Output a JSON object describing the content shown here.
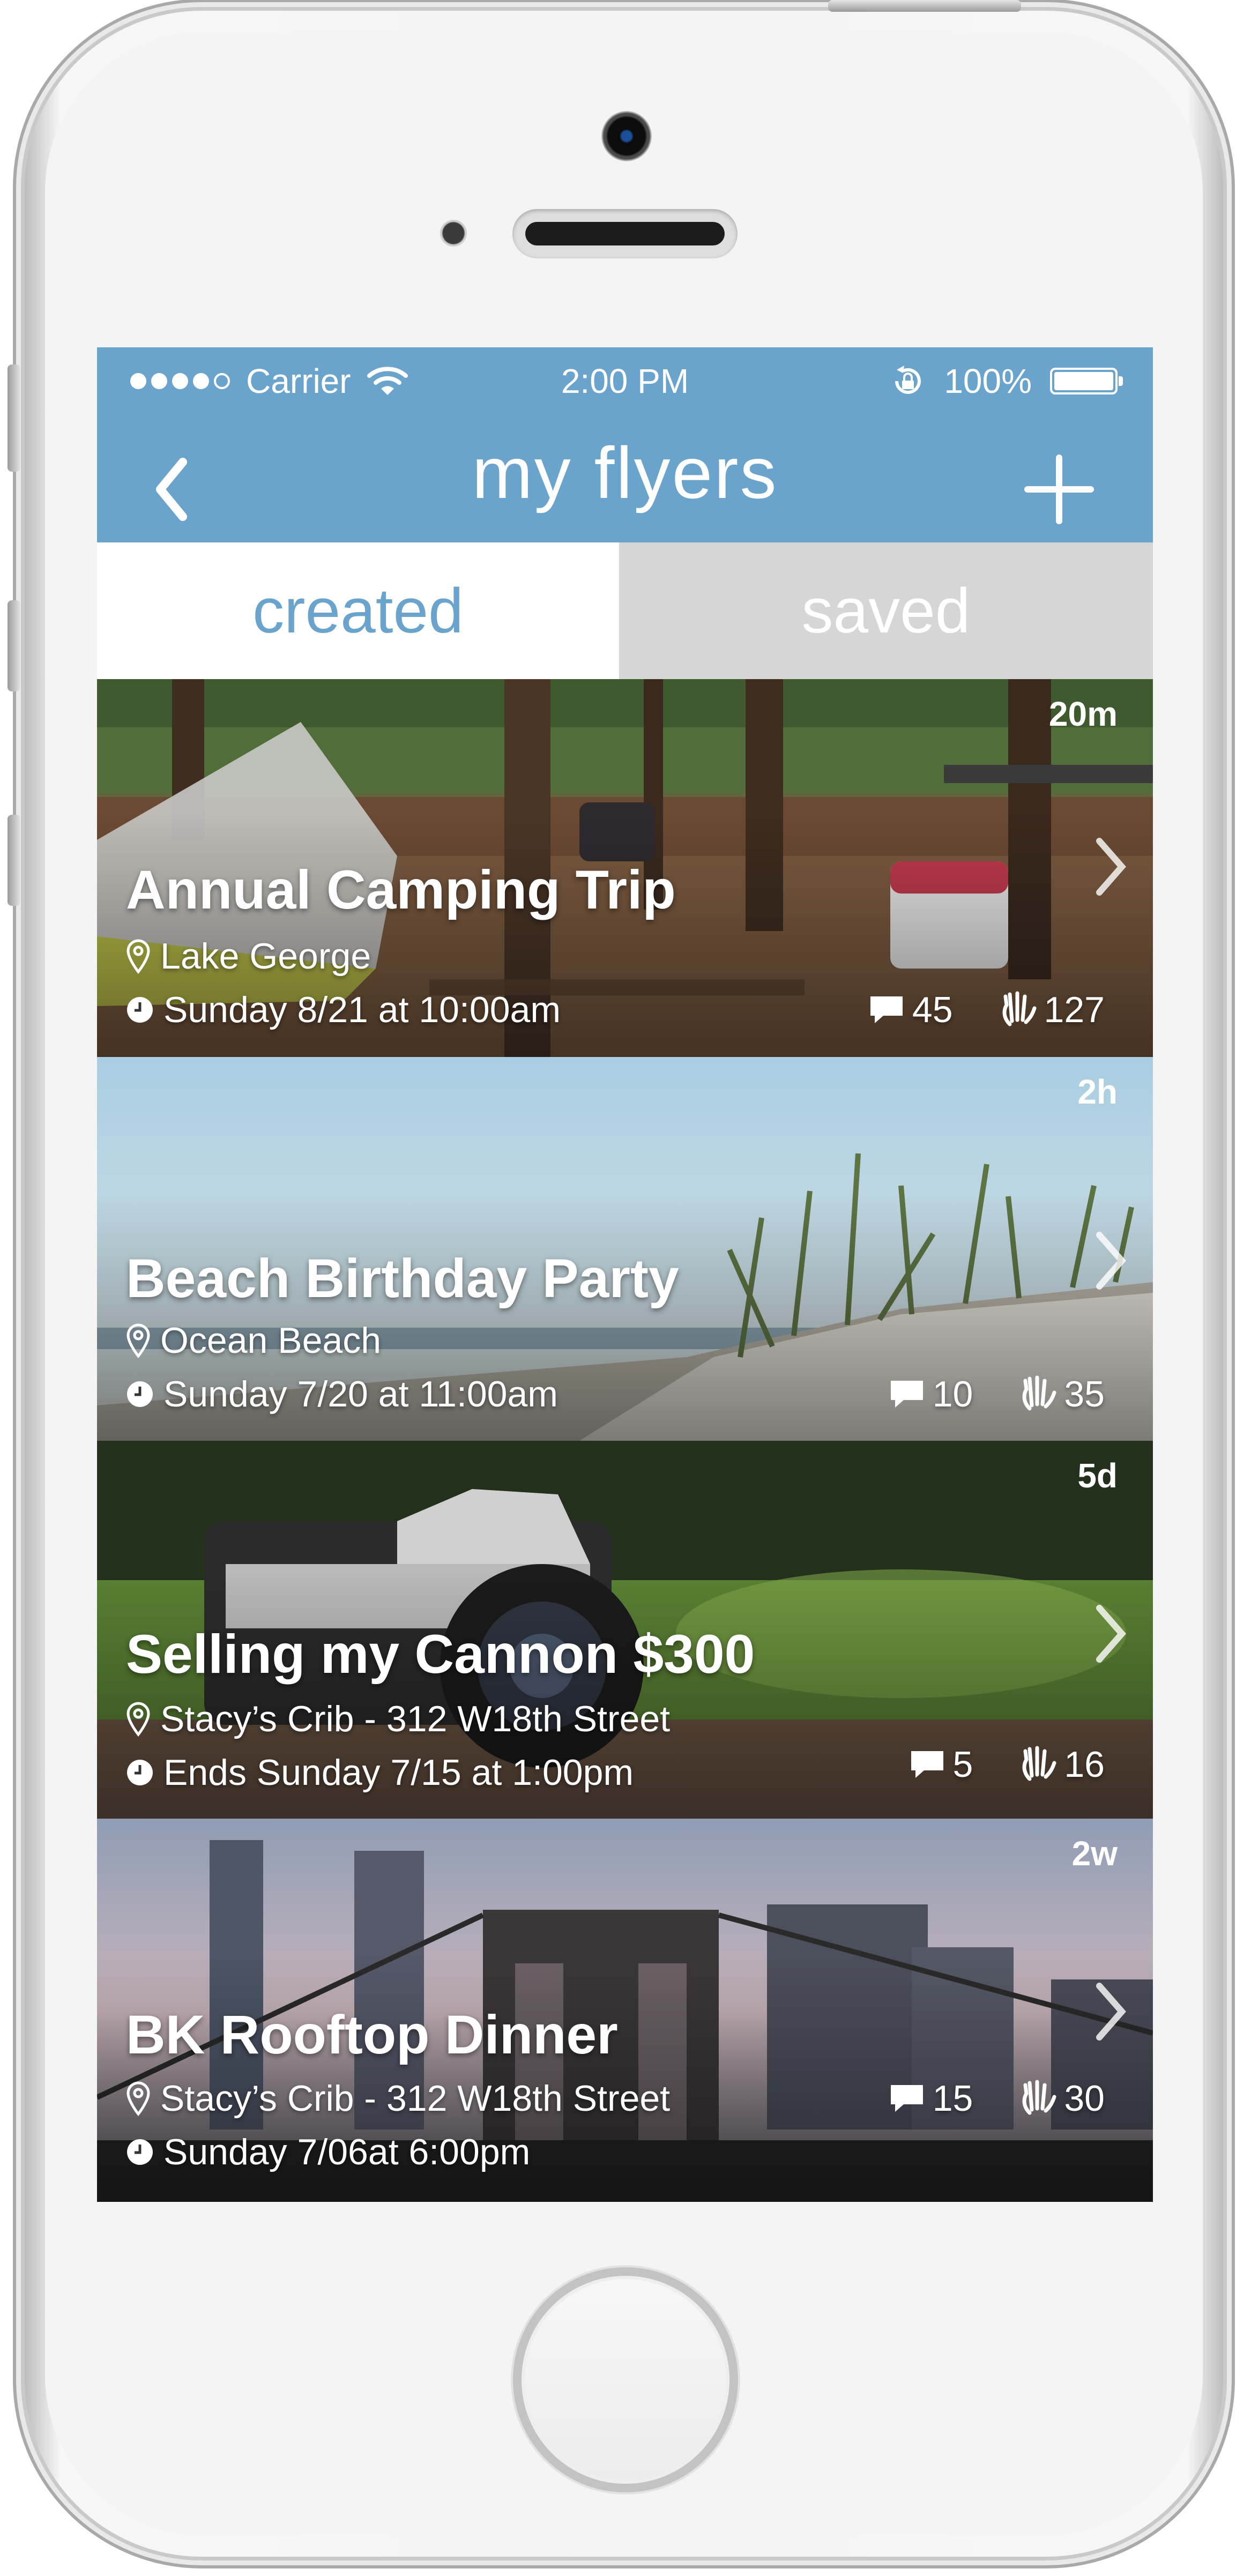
{
  "status_bar": {
    "carrier": "Carrier",
    "time": "2:00 PM",
    "battery": "100%"
  },
  "nav": {
    "title": "my flyers",
    "back_icon": "chevron-left-icon",
    "add_icon": "plus-icon"
  },
  "tabs": {
    "created": "created",
    "saved": "saved",
    "active": "created"
  },
  "flyers": [
    {
      "title": "Annual Camping Trip",
      "location": "Lake George",
      "when": "Sunday 8/21 at 10:00am",
      "age": "20m",
      "comments": "45",
      "waves": "127"
    },
    {
      "title": "Beach Birthday Party",
      "location": "Ocean Beach",
      "when": "Sunday 7/20 at 11:00am",
      "age": "2h",
      "comments": "10",
      "waves": "35"
    },
    {
      "title": "Selling my Cannon $300",
      "location": "Stacy’s Crib - 312 W18th Street",
      "when": "Ends Sunday 7/15 at 1:00pm",
      "age": "5d",
      "comments": "5",
      "waves": "16"
    },
    {
      "title": "BK Rooftop Dinner",
      "location": "Stacy’s Crib - 312 W18th Street",
      "when": "Sunday 7/06at 6:00pm",
      "age": "2w",
      "comments": "15",
      "waves": "30"
    }
  ],
  "colors": {
    "accent": "#6aa4cc",
    "tab_inactive_bg": "#d6d6d6"
  }
}
